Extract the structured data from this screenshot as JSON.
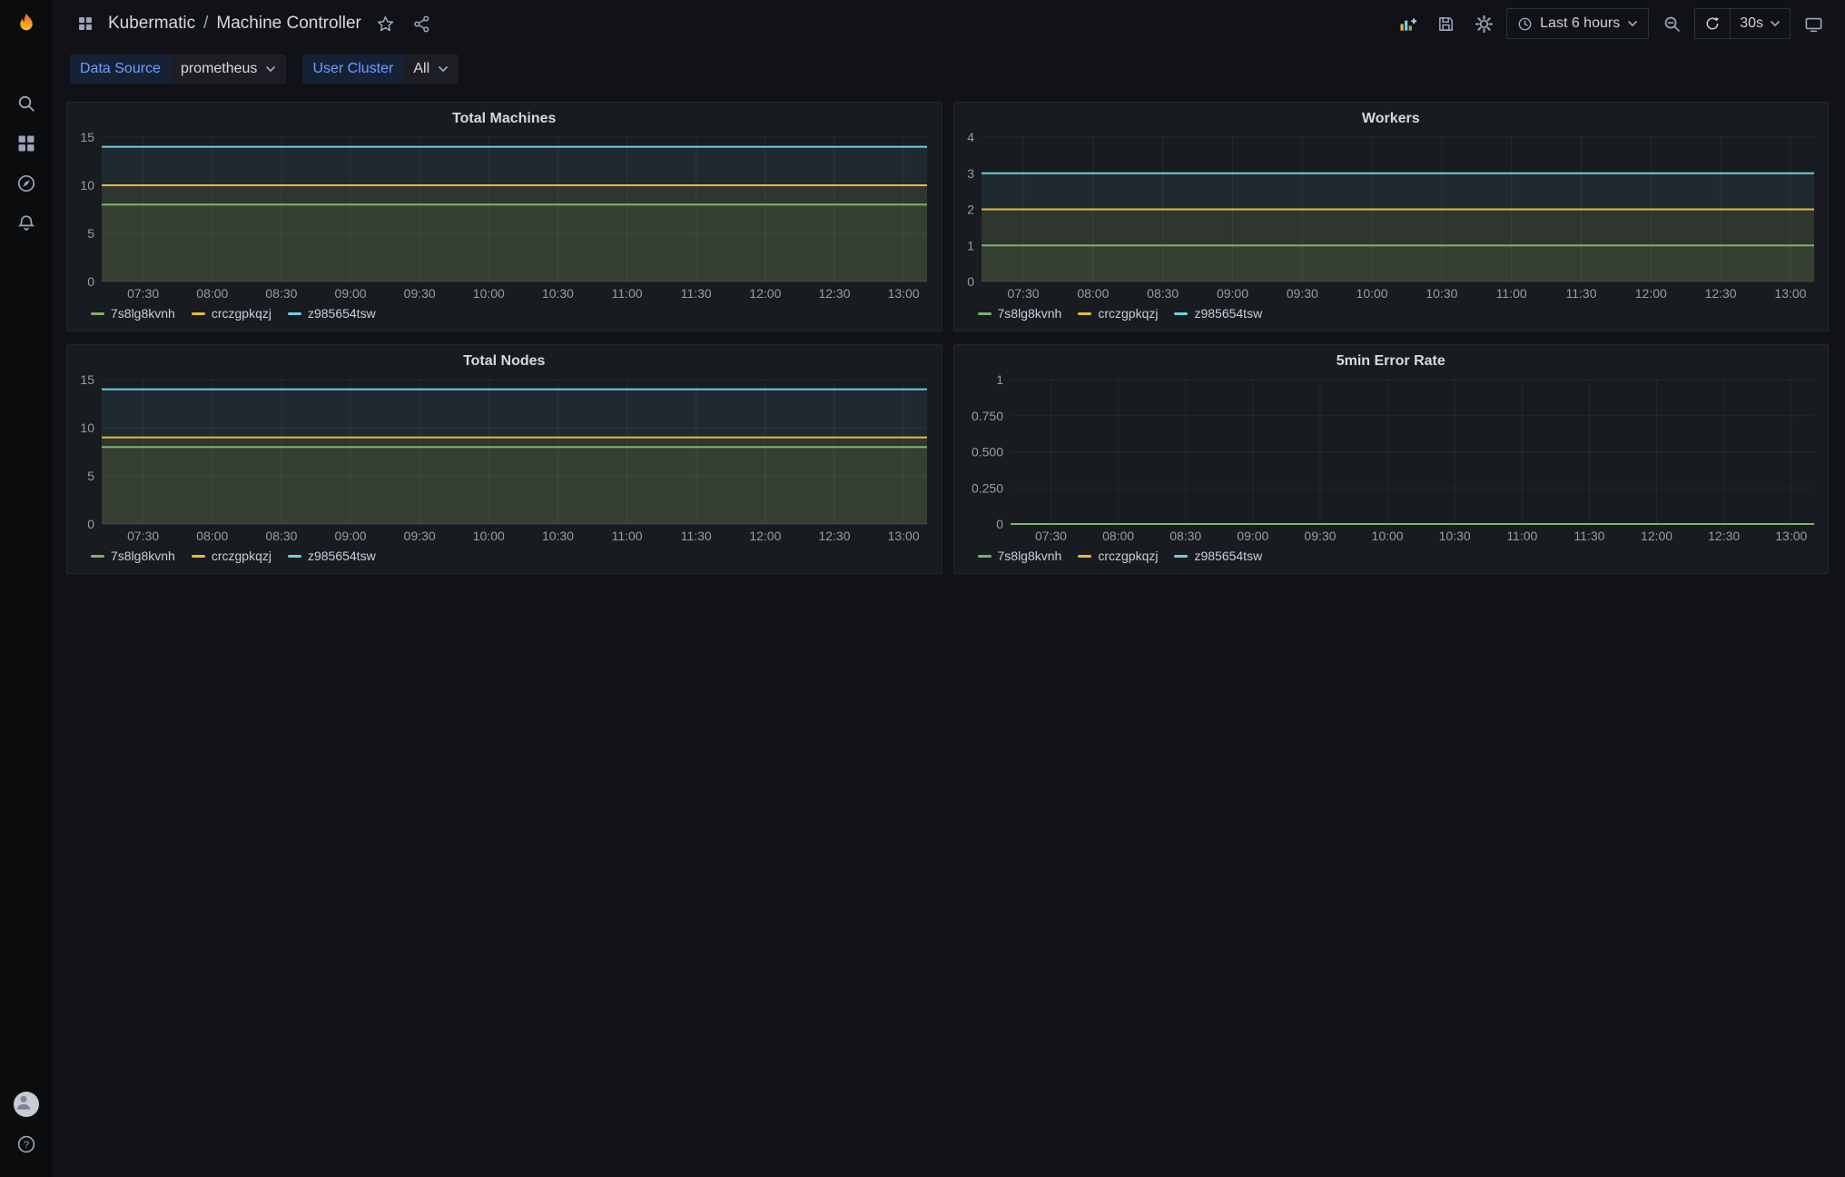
{
  "icons": {
    "help_glyph": "?",
    "sidebar": [
      "search-icon",
      "apps-icon",
      "compass-icon",
      "bell-icon",
      "avatar",
      "help-icon"
    ],
    "topnav": [
      "apps-icon",
      "star-icon",
      "share-icon",
      "add-panel-icon",
      "save-icon",
      "gear-icon",
      "clock-icon",
      "zoom-out-icon",
      "refresh-icon",
      "tv-icon"
    ]
  },
  "breadcrumb": {
    "folder": "Kubermatic",
    "separator": "/",
    "dashboard": "Machine Controller"
  },
  "topnav": {
    "time_range": "Last 6 hours",
    "refresh_interval": "30s"
  },
  "variables": [
    {
      "label": "Data Source",
      "value": "prometheus"
    },
    {
      "label": "User Cluster",
      "value": "All"
    }
  ],
  "chart_data": [
    {
      "type": "line",
      "title": "Total Machines",
      "x_ticks": [
        "07:30",
        "08:00",
        "08:30",
        "09:00",
        "09:30",
        "10:00",
        "10:30",
        "11:00",
        "11:30",
        "12:00",
        "12:30",
        "13:00"
      ],
      "y_ticks": [
        "0",
        "5",
        "10",
        "15"
      ],
      "ylim": [
        0,
        15
      ],
      "grid": true,
      "legend_position": "bottom",
      "series": [
        {
          "name": "7s8lg8kvnh",
          "color": "#7EB26D",
          "value": 8
        },
        {
          "name": "crczgpkqzj",
          "color": "#EAB839",
          "value": 10
        },
        {
          "name": "z985654tsw",
          "color": "#6ED0E0",
          "value": 14
        }
      ]
    },
    {
      "type": "line",
      "title": "Workers",
      "x_ticks": [
        "07:30",
        "08:00",
        "08:30",
        "09:00",
        "09:30",
        "10:00",
        "10:30",
        "11:00",
        "11:30",
        "12:00",
        "12:30",
        "13:00"
      ],
      "y_ticks": [
        "0",
        "1",
        "2",
        "3",
        "4"
      ],
      "ylim": [
        0,
        4
      ],
      "grid": true,
      "legend_position": "bottom",
      "series": [
        {
          "name": "7s8lg8kvnh",
          "color": "#7EB26D",
          "value": 1
        },
        {
          "name": "crczgpkqzj",
          "color": "#EAB839",
          "value": 2
        },
        {
          "name": "z985654tsw",
          "color": "#6ED0E0",
          "value": 3
        }
      ]
    },
    {
      "type": "line",
      "title": "Total Nodes",
      "x_ticks": [
        "07:30",
        "08:00",
        "08:30",
        "09:00",
        "09:30",
        "10:00",
        "10:30",
        "11:00",
        "11:30",
        "12:00",
        "12:30",
        "13:00"
      ],
      "y_ticks": [
        "0",
        "5",
        "10",
        "15"
      ],
      "ylim": [
        0,
        15
      ],
      "grid": true,
      "legend_position": "bottom",
      "series": [
        {
          "name": "7s8lg8kvnh",
          "color": "#7EB26D",
          "value": 8
        },
        {
          "name": "crczgpkqzj",
          "color": "#EAB839",
          "value": 9
        },
        {
          "name": "z985654tsw",
          "color": "#6ED0E0",
          "value": 14
        }
      ]
    },
    {
      "type": "line",
      "title": "5min Error Rate",
      "x_ticks": [
        "07:30",
        "08:00",
        "08:30",
        "09:00",
        "09:30",
        "10:00",
        "10:30",
        "11:00",
        "11:30",
        "12:00",
        "12:30",
        "13:00"
      ],
      "y_ticks": [
        "0",
        "0.250",
        "0.500",
        "0.750",
        "1"
      ],
      "ylim": [
        0,
        1
      ],
      "grid": true,
      "legend_position": "bottom",
      "series": [
        {
          "name": "7s8lg8kvnh",
          "color": "#7EB26D",
          "value": 0
        },
        {
          "name": "crczgpkqzj",
          "color": "#EAB839",
          "value": 0
        },
        {
          "name": "z985654tsw",
          "color": "#6ED0E0",
          "value": 0
        }
      ]
    }
  ]
}
